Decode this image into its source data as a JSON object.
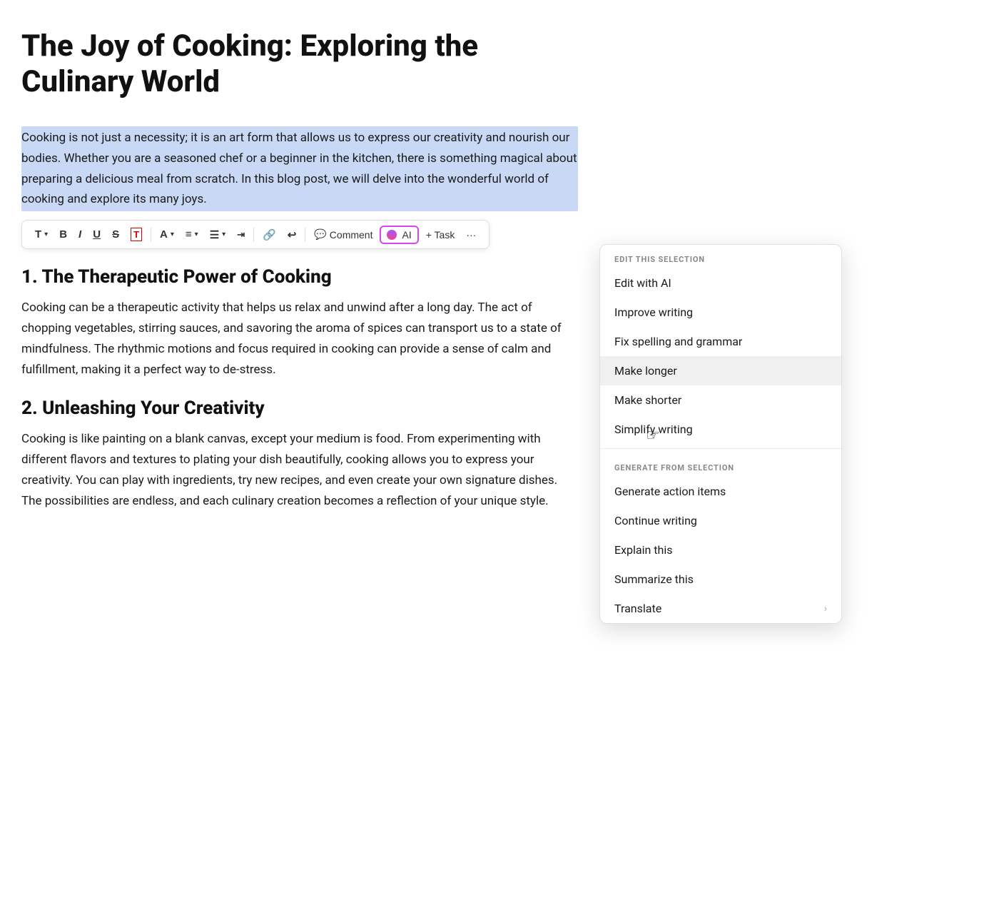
{
  "document": {
    "title": "The Joy of Cooking: Exploring the Culinary World",
    "selected_paragraph": "Cooking is not just a necessity; it is an art form that allows us to express our creativity and nourish our bodies. Whether you are a seasoned chef or a beginner in the kitchen, there is something magical about preparing a delicious meal from scratch. In this blog post, we will delve into the wonderful world of cooking and explore its many joys.",
    "sections": [
      {
        "heading": "1. The Therapeutic Power of Cooking",
        "body": "Cooking can be a therapeutic activity that helps us relax and unwind after a long day. The act of chopping vegetables, stirring sauces, and savoring the aroma of spices can transport us to a state of mindfulness. The rhythmic motions and focus required in cooking can provide a sense of calm and fulfillment, making it a perfect way to de-stress."
      },
      {
        "heading": "2. Unleashing Your Creativity",
        "body": "Cooking is like painting on a blank canvas, except your medium is food. From experimenting with different flavors and textures to plating your dish beautifully, cooking allows you to express your creativity. You can play with ingredients, try new recipes, and even create your own signature dishes. The possibilities are endless, and each culinary creation becomes a reflection of your unique style."
      }
    ]
  },
  "toolbar": {
    "buttons": [
      {
        "label": "T",
        "title": "Text style",
        "has_dropdown": true
      },
      {
        "label": "B",
        "title": "Bold"
      },
      {
        "label": "I",
        "title": "Italic"
      },
      {
        "label": "U",
        "title": "Underline"
      },
      {
        "label": "S",
        "title": "Strikethrough"
      },
      {
        "label": "▣",
        "title": "Highlight"
      },
      {
        "label": "A",
        "title": "Text color",
        "has_dropdown": true
      },
      {
        "label": "≡",
        "title": "Align",
        "has_dropdown": true
      },
      {
        "label": "≔",
        "title": "List",
        "has_dropdown": true
      },
      {
        "label": "⋮≡",
        "title": "Indent"
      },
      {
        "label": "🔗",
        "title": "Link"
      },
      {
        "label": "↩",
        "title": "Quote"
      },
      {
        "label": "Comment",
        "title": "Comment",
        "is_text": true,
        "icon": "💬"
      },
      {
        "label": "AI",
        "title": "AI",
        "is_ai": true
      },
      {
        "label": "+ Task",
        "title": "Add task",
        "is_text": true
      },
      {
        "label": "•••",
        "title": "More options"
      }
    ],
    "comment_label": "Comment",
    "ai_label": "AI",
    "task_label": "+ Task",
    "more_label": "···"
  },
  "ai_menu": {
    "edit_section_label": "EDIT THIS SELECTION",
    "generate_section_label": "GENERATE FROM SELECTION",
    "edit_items": [
      {
        "label": "Edit with AI",
        "has_arrow": false
      },
      {
        "label": "Improve writing",
        "has_arrow": false
      },
      {
        "label": "Fix spelling and grammar",
        "has_arrow": false
      },
      {
        "label": "Make longer",
        "has_arrow": false,
        "highlighted": true
      },
      {
        "label": "Make shorter",
        "has_arrow": false
      },
      {
        "label": "Simplify writing",
        "has_arrow": false
      }
    ],
    "generate_items": [
      {
        "label": "Generate action items",
        "has_arrow": false
      },
      {
        "label": "Continue writing",
        "has_arrow": false
      },
      {
        "label": "Explain this",
        "has_arrow": false
      },
      {
        "label": "Summarize this",
        "has_arrow": false
      },
      {
        "label": "Translate",
        "has_arrow": true
      }
    ]
  }
}
